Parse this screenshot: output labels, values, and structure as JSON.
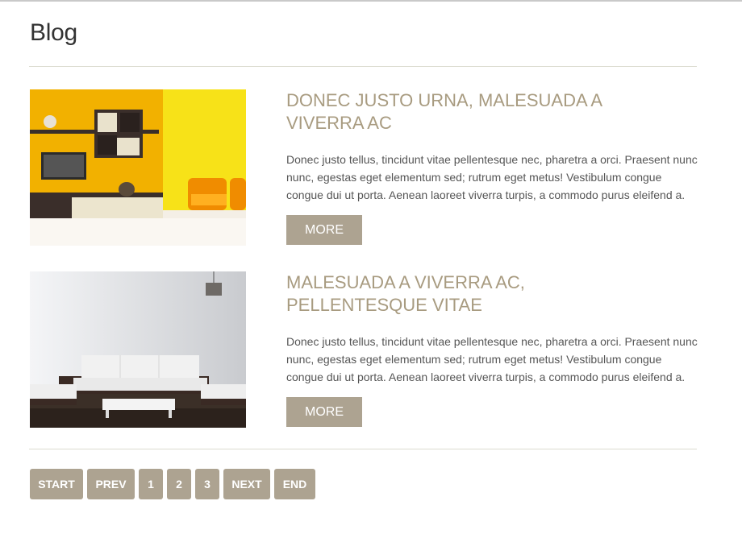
{
  "page": {
    "title": "Blog"
  },
  "posts": [
    {
      "title": "DONEC JUSTO URNA, MALESUADA A VIVERRA AC",
      "text": "Donec justo tellus, tincidunt vitae pellentesque nec, pharetra a orci. Praesent nunc nunc, egestas eget elementum sed; rutrum eget metus! Vestibulum congue congue dui ut porta. Aenean laoreet viverra turpis, a commodo purus eleifend a.",
      "more_label": "MORE"
    },
    {
      "title": "MALESUADA A VIVERRA AC, PELLENTESQUE VITAE",
      "text": "Donec justo tellus, tincidunt vitae pellentesque nec, pharetra a orci. Praesent nunc nunc, egestas eget elementum sed; rutrum eget metus! Vestibulum congue congue dui ut porta. Aenean laoreet viverra turpis, a commodo purus eleifend a.",
      "more_label": "MORE"
    }
  ],
  "pagination": {
    "start": "START",
    "prev": "PREV",
    "pages": [
      "1",
      "2",
      "3"
    ],
    "next": "NEXT",
    "end": "END"
  }
}
